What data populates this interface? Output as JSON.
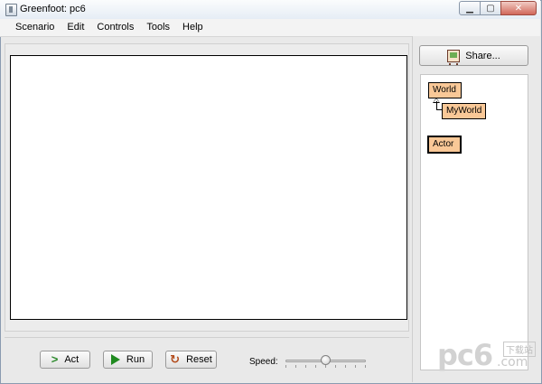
{
  "window": {
    "title": "Greenfoot: pc6",
    "controls": {
      "minimize": "▁",
      "maximize": "▢",
      "close": "✕"
    }
  },
  "menu": [
    "Scenario",
    "Edit",
    "Controls",
    "Tools",
    "Help"
  ],
  "share": {
    "label": "Share..."
  },
  "classes": {
    "world": "World",
    "myworld": "MyWorld",
    "actor": "Actor"
  },
  "controls": {
    "act": "Act",
    "run": "Run",
    "reset": "Reset",
    "speed_label": "Speed:",
    "speed_level": 0.5
  },
  "icons": {
    "act": "step-arrow-icon",
    "run": "play-icon",
    "reset": "reset-icon",
    "share": "easel-icon"
  },
  "watermark": {
    "logo": "pc6",
    "cn": "下载站",
    "domain": ".com"
  },
  "colors": {
    "class_box": "#f9c897",
    "run_green": "#1f8a1f",
    "reset_orange": "#b24a1a"
  }
}
